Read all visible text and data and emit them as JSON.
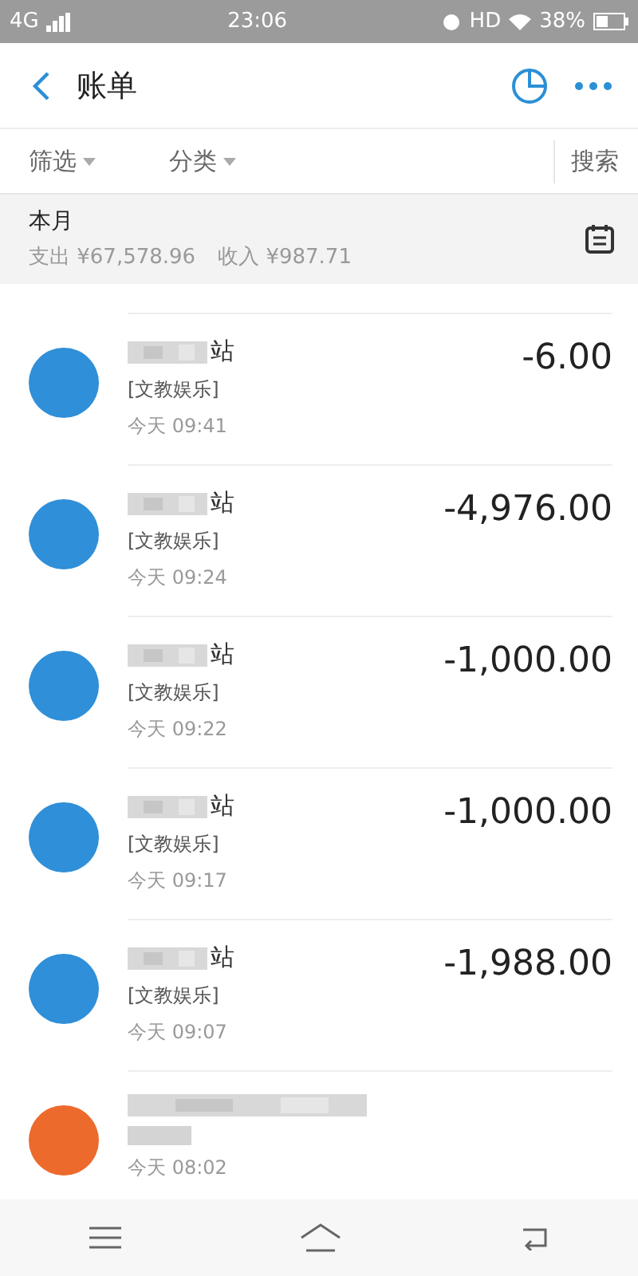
{
  "status_bar": {
    "network": "4G",
    "time": "23:06",
    "hd": "HD",
    "battery": "38%"
  },
  "header": {
    "title": "账单"
  },
  "filters": [
    {
      "label": "筛选"
    },
    {
      "label": "分类"
    }
  ],
  "search": "搜索",
  "summary": {
    "period": "本月",
    "expense": "支出 ¥67,578.96",
    "income": "收入 ¥987.71"
  },
  "transactions": [
    {
      "name_visible": "站",
      "category": "[文教娱乐]",
      "time": "今天  09:41",
      "amount": "-6.00",
      "color": "#2f8fd8"
    },
    {
      "name_visible": "站",
      "category": "[文教娱乐]",
      "time": "今天  09:24",
      "amount": "-4,976.00",
      "color": "#2f8fd8"
    },
    {
      "name_visible": "站",
      "category": "[文教娱乐]",
      "time": "今天  09:22",
      "amount": "-1,000.00",
      "color": "#2f8fd8"
    },
    {
      "name_visible": "站",
      "category": "[文教娱乐]",
      "time": "今天  09:17",
      "amount": "-1,000.00",
      "color": "#2f8fd8"
    },
    {
      "name_visible": "站",
      "category": "[文教娱乐]",
      "time": "今天  09:07",
      "amount": "-1,988.00",
      "color": "#2f8fd8"
    },
    {
      "time": "今天  08:02",
      "color": "#ec6a2c"
    }
  ]
}
